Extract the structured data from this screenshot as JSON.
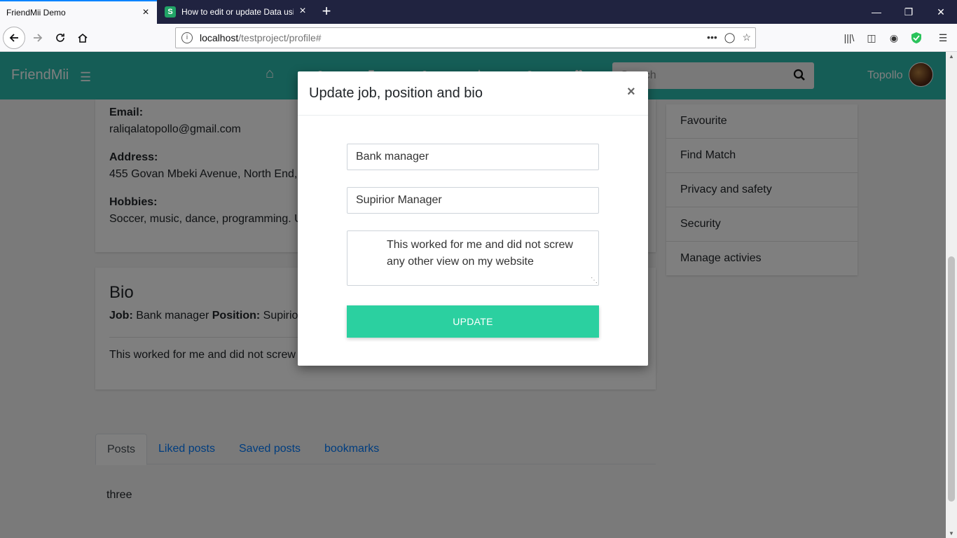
{
  "browser": {
    "tabs": [
      {
        "title": "FriendMii Demo",
        "active": true
      },
      {
        "title": "How to edit or update Data usin",
        "favicon": "S",
        "active": false
      }
    ],
    "url_host": "localhost",
    "url_path": "/testproject/profile#"
  },
  "site": {
    "brand": "FriendMii",
    "search_placeholder": "Search",
    "user_name": "Topollo",
    "accent_color": "#2bbbad"
  },
  "profile": {
    "email_label": "Email:",
    "email": "raliqalatopollo@gmail.com",
    "address_label": "Address:",
    "address": "455 Govan Mbeki Avenue, North End,",
    "hobbies_label": "Hobbies:",
    "hobbies": "Soccer, music, dance, programming. U"
  },
  "bio": {
    "title": "Bio",
    "job_label": "Job:",
    "job": "Bank manager",
    "position_label": "Position:",
    "position": "Supirio",
    "text": "This worked for me and did not screw"
  },
  "side_menu": [
    "Favourite",
    "Find Match",
    "Privacy and safety",
    "Security",
    "Manage activies"
  ],
  "post_tabs": [
    "Posts",
    "Liked posts",
    "Saved posts",
    "bookmarks"
  ],
  "post_content": "three",
  "modal": {
    "title": "Update job, position and bio",
    "close": "×",
    "job_value": "Bank manager",
    "position_value": "Supirior Manager",
    "bio_value": "This worked for me and did not screw any other view on my website",
    "update_label": "UPDATE",
    "button_color": "#2bd0a0"
  }
}
